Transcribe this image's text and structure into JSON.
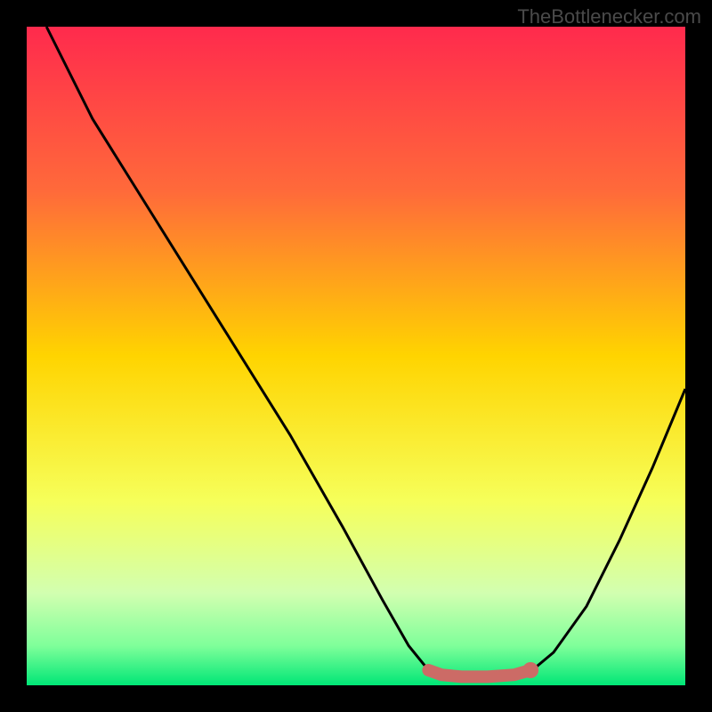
{
  "watermark": "TheBottlenecker.com",
  "chart_data": {
    "type": "line",
    "title": "",
    "xlabel": "",
    "ylabel": "",
    "xlim": [
      0,
      100
    ],
    "ylim": [
      0,
      100
    ],
    "gradient_stops": [
      {
        "offset": 0,
        "color": "#ff2a4d"
      },
      {
        "offset": 25,
        "color": "#ff6a3a"
      },
      {
        "offset": 50,
        "color": "#ffd400"
      },
      {
        "offset": 72,
        "color": "#f6ff5a"
      },
      {
        "offset": 86,
        "color": "#d2ffb0"
      },
      {
        "offset": 94,
        "color": "#7fff9a"
      },
      {
        "offset": 100,
        "color": "#00e676"
      }
    ],
    "series": [
      {
        "name": "bottleneck-curve",
        "stroke": "#000000",
        "points": [
          {
            "x": 3,
            "y": 100
          },
          {
            "x": 10,
            "y": 86
          },
          {
            "x": 20,
            "y": 70
          },
          {
            "x": 30,
            "y": 54
          },
          {
            "x": 40,
            "y": 38
          },
          {
            "x": 48,
            "y": 24
          },
          {
            "x": 54,
            "y": 13
          },
          {
            "x": 58,
            "y": 6
          },
          {
            "x": 61,
            "y": 2.3
          },
          {
            "x": 63,
            "y": 1.5
          },
          {
            "x": 66,
            "y": 1.2
          },
          {
            "x": 70,
            "y": 1.2
          },
          {
            "x": 74,
            "y": 1.5
          },
          {
            "x": 77,
            "y": 2.5
          },
          {
            "x": 80,
            "y": 5
          },
          {
            "x": 85,
            "y": 12
          },
          {
            "x": 90,
            "y": 22
          },
          {
            "x": 95,
            "y": 33
          },
          {
            "x": 100,
            "y": 45
          }
        ]
      },
      {
        "name": "highlight-band",
        "stroke": "#cc6b66",
        "thick": true,
        "points": [
          {
            "x": 61,
            "y": 2.3
          },
          {
            "x": 63,
            "y": 1.6
          },
          {
            "x": 66,
            "y": 1.3
          },
          {
            "x": 70,
            "y": 1.3
          },
          {
            "x": 74,
            "y": 1.6
          },
          {
            "x": 76.5,
            "y": 2.3
          }
        ]
      }
    ],
    "marker": {
      "x": 76.5,
      "y": 2.3,
      "color": "#cc6b66"
    }
  }
}
